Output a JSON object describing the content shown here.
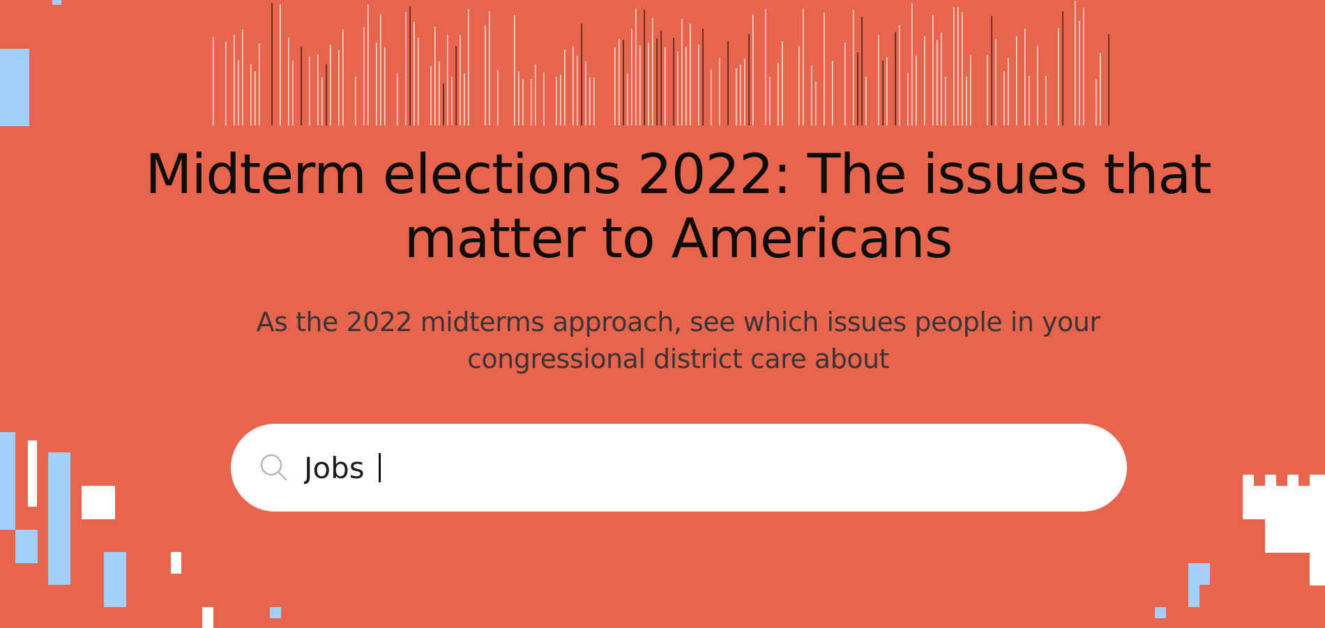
{
  "page": {
    "headline": "Midterm elections 2022: The issues that matter to Americans",
    "subheadline": "As the 2022 midterms approach, see which issues people in your congressional district care about"
  },
  "search": {
    "value": "Jobs",
    "icon": "search-icon"
  },
  "colors": {
    "background": "#E8654D",
    "accent_blue": "#A3CFF8",
    "white": "#FFFFFF",
    "dark_stripes": "#4A1E12",
    "text": "#0D0D0D"
  }
}
